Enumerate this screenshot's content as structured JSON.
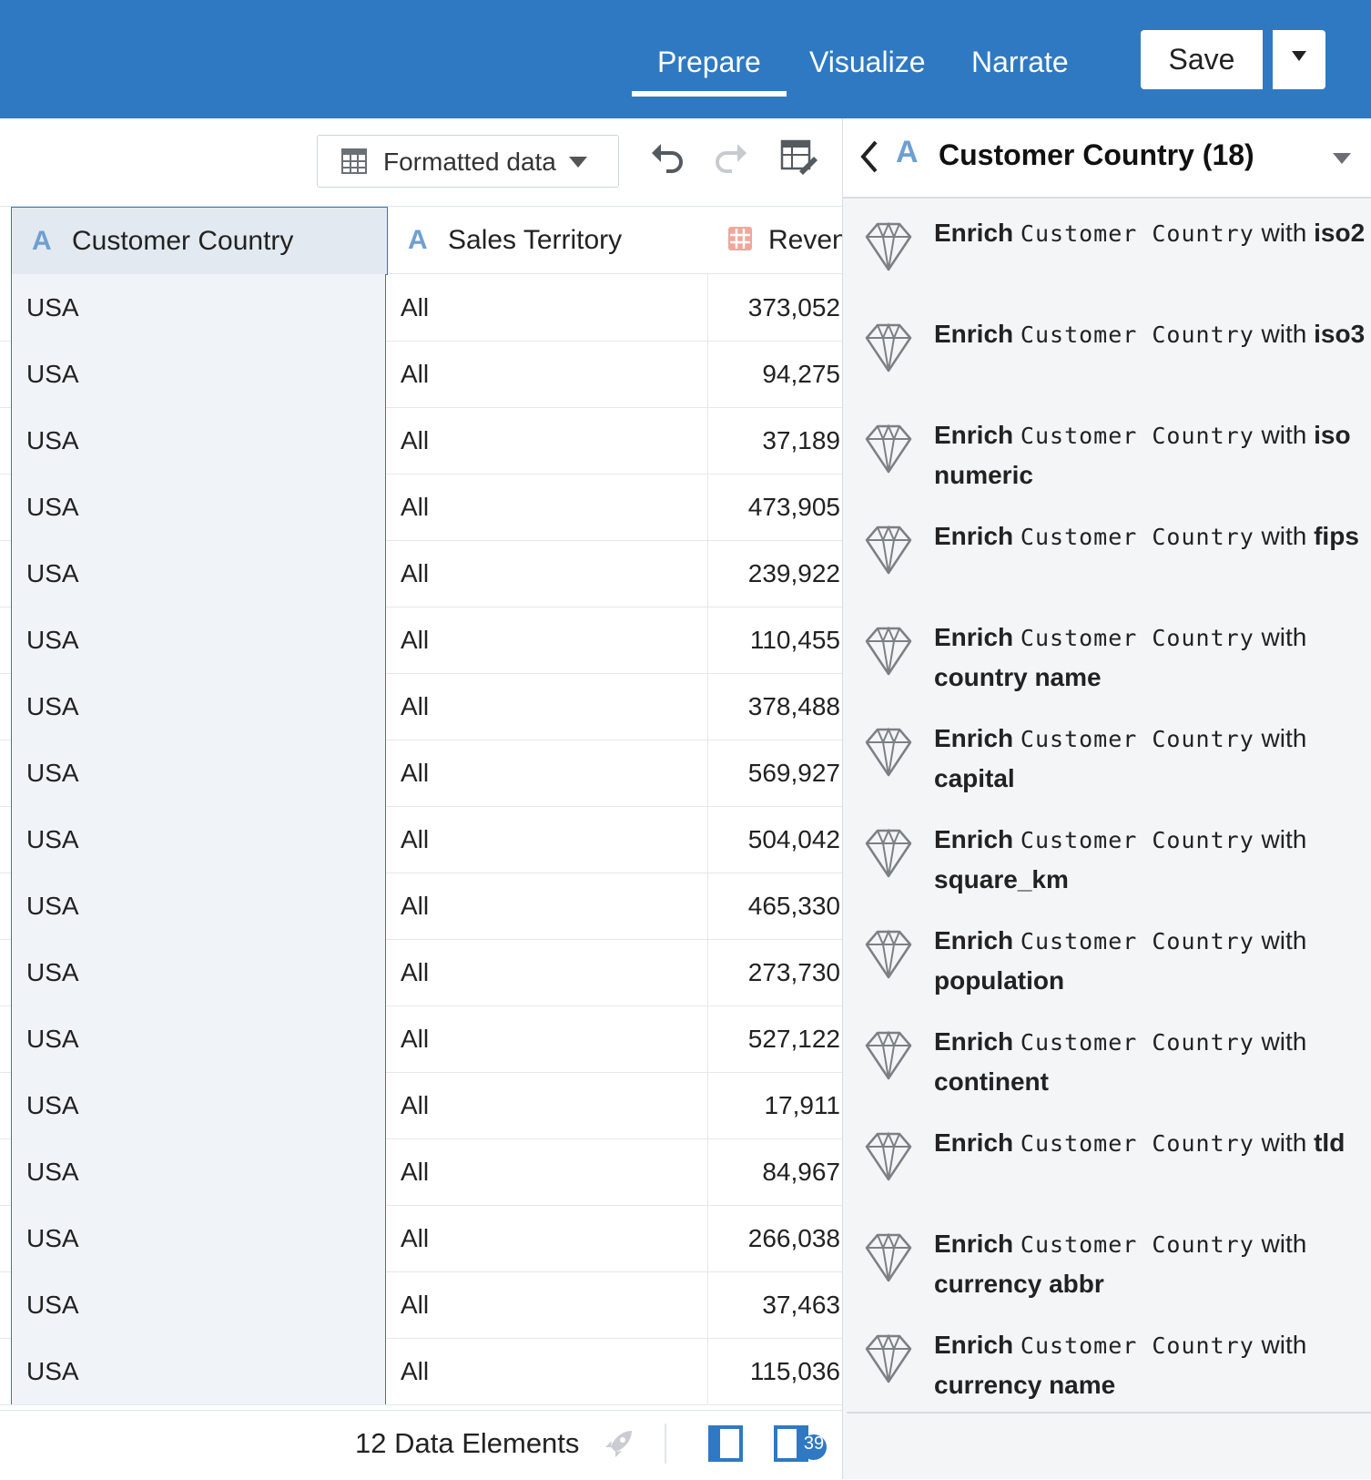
{
  "topbar": {
    "tabs": [
      {
        "label": "Prepare",
        "active": true
      },
      {
        "label": "Visualize",
        "active": false
      },
      {
        "label": "Narrate",
        "active": false
      }
    ],
    "save_label": "Save",
    "bg_color": "#2f79c2"
  },
  "toolbar": {
    "format_label": "Formatted data",
    "icons": [
      "table-icon",
      "undo-icon",
      "redo-icon",
      "edit-grid-icon"
    ]
  },
  "grid": {
    "columns": [
      {
        "label": "Customer Country",
        "type_icon": "text-attribute-icon",
        "glyph": "A"
      },
      {
        "label": "Sales Territory",
        "type_icon": "text-attribute-icon",
        "glyph": "A"
      },
      {
        "label": "Reven",
        "type_icon": "measure-hash-icon",
        "glyph": "#"
      }
    ],
    "rows": [
      [
        "USA",
        "All",
        "373,052"
      ],
      [
        "USA",
        "All",
        "94,275"
      ],
      [
        "USA",
        "All",
        "37,189"
      ],
      [
        "USA",
        "All",
        "473,905"
      ],
      [
        "USA",
        "All",
        "239,922"
      ],
      [
        "USA",
        "All",
        "110,455"
      ],
      [
        "USA",
        "All",
        "378,488"
      ],
      [
        "USA",
        "All",
        "569,927"
      ],
      [
        "USA",
        "All",
        "504,042"
      ],
      [
        "USA",
        "All",
        "465,330"
      ],
      [
        "USA",
        "All",
        "273,730"
      ],
      [
        "USA",
        "All",
        "527,122"
      ],
      [
        "USA",
        "All",
        "17,911"
      ],
      [
        "USA",
        "All",
        "84,967"
      ],
      [
        "USA",
        "All",
        "266,038"
      ],
      [
        "USA",
        "All",
        "37,463"
      ],
      [
        "USA",
        "All",
        "115,036"
      ]
    ]
  },
  "footer": {
    "count_label": "12 Data Elements",
    "badge": "39"
  },
  "panel": {
    "glyph": "A",
    "title": "Customer Country (18)",
    "enrich_word": "Enrich",
    "column_word": "Customer Country",
    "with_word": "with",
    "items": [
      "iso2",
      "iso3",
      "iso numeric",
      "fips",
      "country name",
      "capital",
      "square_km",
      "population",
      "continent",
      "tld",
      "currency abbr",
      "currency name"
    ]
  }
}
